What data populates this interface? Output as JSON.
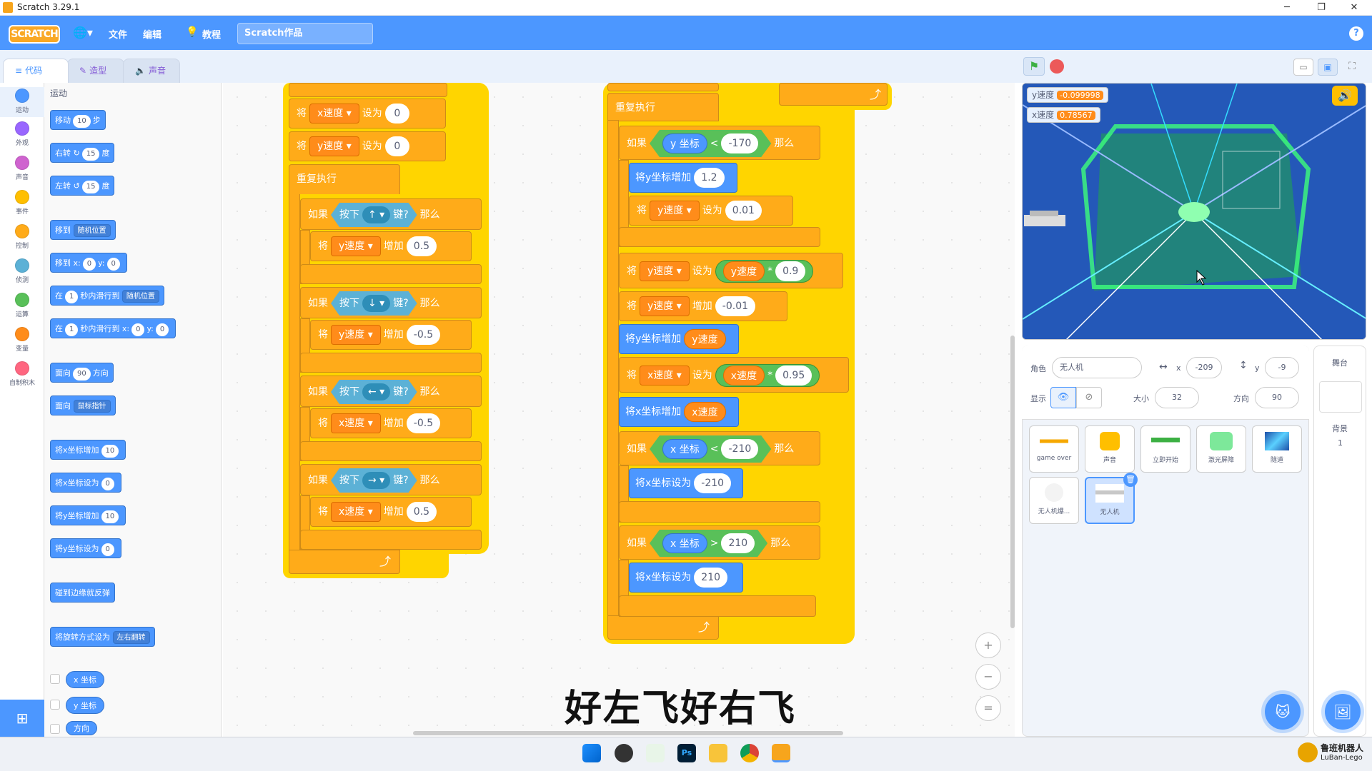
{
  "window": {
    "title": "Scratch 3.29.1",
    "min": "─",
    "max": "❐",
    "close": "✕"
  },
  "menubar": {
    "logo": "SCRATCH",
    "lang_icon": "globe-icon",
    "file": "文件",
    "edit": "编辑",
    "tutorials": "教程",
    "project_name": "Scratch作品",
    "help": "?"
  },
  "tabs": [
    {
      "label": "代码",
      "icon": "code-icon"
    },
    {
      "label": "造型",
      "icon": "brush-icon"
    },
    {
      "label": "声音",
      "icon": "speaker-icon"
    }
  ],
  "categories": [
    {
      "label": "运动",
      "color": "#4c97ff"
    },
    {
      "label": "外观",
      "color": "#9966ff"
    },
    {
      "label": "声音",
      "color": "#cf63cf"
    },
    {
      "label": "事件",
      "color": "#ffbf00"
    },
    {
      "label": "控制",
      "color": "#ffab19"
    },
    {
      "label": "侦测",
      "color": "#5cb1d6"
    },
    {
      "label": "运算",
      "color": "#59c059"
    },
    {
      "label": "变量",
      "color": "#ff8c1a"
    },
    {
      "label": "自制积木",
      "color": "#ff6680"
    }
  ],
  "palette": {
    "header": "运动",
    "move": {
      "a": "移动",
      "v": "10",
      "b": "步"
    },
    "turn_r": {
      "a": "右转",
      "v": "15",
      "b": "度"
    },
    "turn_l": {
      "a": "左转",
      "v": "15",
      "b": "度"
    },
    "goto": {
      "a": "移到",
      "dd": "随机位置"
    },
    "gotoxy": {
      "a": "移到 x:",
      "x": "0",
      "b": "y:",
      "y": "0"
    },
    "glide": {
      "a": "在",
      "v": "1",
      "b": "秒内滑行到",
      "dd": "随机位置"
    },
    "glidexy": {
      "a": "在",
      "v": "1",
      "b": "秒内滑行到 x:",
      "x": "0",
      "c": "y:",
      "y": "0"
    },
    "point": {
      "a": "面向",
      "v": "90",
      "b": "方向"
    },
    "pointto": {
      "a": "面向",
      "dd": "鼠标指针"
    },
    "chx": {
      "a": "将x坐标增加",
      "v": "10"
    },
    "setx": {
      "a": "将x坐标设为",
      "v": "0"
    },
    "chy": {
      "a": "将y坐标增加",
      "v": "10"
    },
    "sety": {
      "a": "将y坐标设为",
      "v": "0"
    },
    "bounce": "碰到边缘就反弹",
    "rotstyle": {
      "a": "将旋转方式设为",
      "dd": "左右翻转"
    },
    "rep_x": "x 坐标",
    "rep_y": "y 坐标",
    "rep_dir": "方向"
  },
  "script1": {
    "set1": {
      "a": "将",
      "var": "x速度",
      "b": "设为",
      "v": "0"
    },
    "set2": {
      "a": "将",
      "var": "y速度",
      "b": "设为",
      "v": "0"
    },
    "forever": "重复执行",
    "if_up": {
      "a": "如果",
      "k": "按下",
      "key": "↑",
      "q": "键?",
      "then": "那么"
    },
    "ch_up": {
      "a": "将",
      "var": "y速度",
      "b": "增加",
      "v": "0.5"
    },
    "if_down": {
      "a": "如果",
      "k": "按下",
      "key": "↓",
      "q": "键?",
      "then": "那么"
    },
    "ch_down": {
      "a": "将",
      "var": "y速度",
      "b": "增加",
      "v": "-0.5"
    },
    "if_left": {
      "a": "如果",
      "k": "按下",
      "key": "←",
      "q": "键?",
      "then": "那么"
    },
    "ch_left": {
      "a": "将",
      "var": "x速度",
      "b": "增加",
      "v": "-0.5"
    },
    "if_right": {
      "a": "如果",
      "k": "按下",
      "key": "→",
      "q": "键?",
      "then": "那么"
    },
    "ch_right": {
      "a": "将",
      "var": "x速度",
      "b": "增加",
      "v": "0.5"
    },
    "loop_icon": "⤴"
  },
  "script2": {
    "forever": "重复执行",
    "if1": {
      "a": "如果",
      "rep": "y 坐标",
      "op": "<",
      "v": "-170",
      "then": "那么"
    },
    "chy": {
      "a": "将y坐标增加",
      "v": "1.2"
    },
    "setyv": {
      "a": "将",
      "var": "y速度",
      "b": "设为",
      "v": "0.01"
    },
    "setvy": {
      "a": "将",
      "var": "y速度",
      "b": "设为",
      "r": "y速度",
      "op": "*",
      "v": "0.9"
    },
    "chvy": {
      "a": "将",
      "var": "y速度",
      "b": "增加",
      "v": "-0.01"
    },
    "addy": {
      "a": "将y坐标增加",
      "r": "y速度"
    },
    "setvx": {
      "a": "将",
      "var": "x速度",
      "b": "设为",
      "r": "x速度",
      "op": "*",
      "v": "0.95"
    },
    "addx": {
      "a": "将x坐标增加",
      "r": "x速度"
    },
    "if2": {
      "a": "如果",
      "rep": "x 坐标",
      "op": "<",
      "v": "-210",
      "then": "那么"
    },
    "setx1": {
      "a": "将x坐标设为",
      "v": "-210"
    },
    "if3": {
      "a": "如果",
      "rep": "x 坐标",
      "op": ">",
      "v": "210",
      "then": "那么"
    },
    "setx2": {
      "a": "将x坐标设为",
      "v": "210"
    }
  },
  "subtitle": "好左飞好右飞",
  "stage": {
    "monitors": [
      {
        "label": "y速度",
        "value": "-0.099998"
      },
      {
        "label": "x速度",
        "value": "0.78567"
      }
    ]
  },
  "sprite_info": {
    "sprite_label": "角色",
    "sprite_name": "无人机",
    "x_label": "x",
    "x": "-209",
    "y_label": "y",
    "y": "-9",
    "show_label": "显示",
    "size_label": "大小",
    "size": "32",
    "dir_label": "方向",
    "dir": "90"
  },
  "sprites": [
    {
      "name": "game over"
    },
    {
      "name": "声音"
    },
    {
      "name": "立即开始"
    },
    {
      "name": "激光屏障"
    },
    {
      "name": "隧道"
    },
    {
      "name": "无人机爆..."
    },
    {
      "name": "无人机"
    }
  ],
  "stage_pane": {
    "title": "舞台",
    "backdrops_label": "背景",
    "backdrops": "1"
  },
  "brand": {
    "line1": "鲁班机器人",
    "line2": "LuBan-Lego"
  }
}
